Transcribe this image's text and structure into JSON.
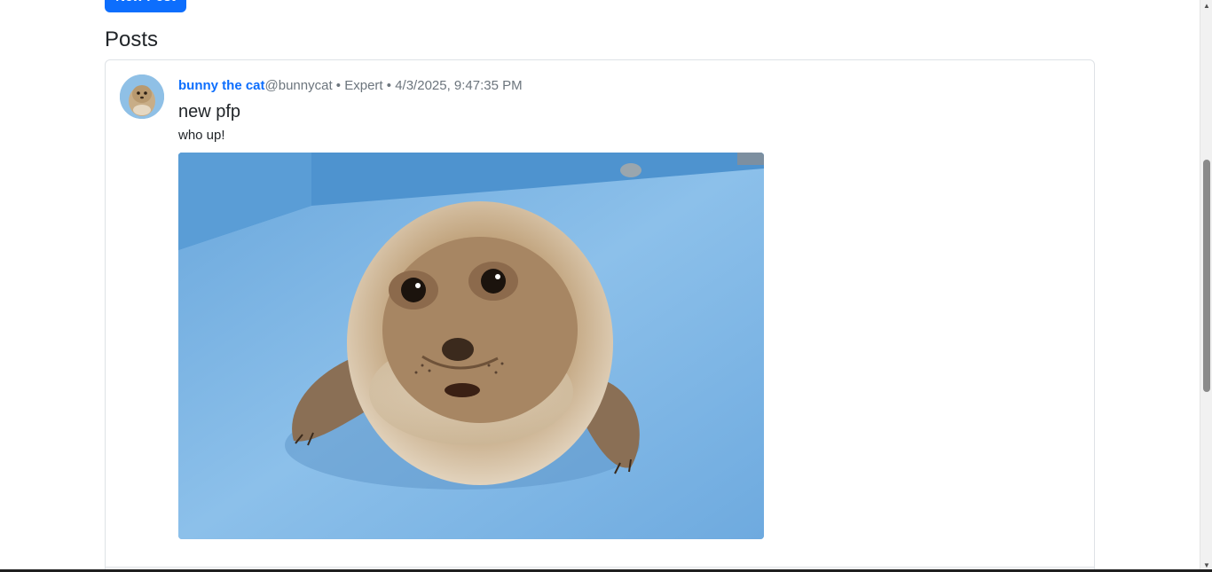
{
  "toolbar": {
    "new_post_label": "New Post"
  },
  "posts_section": {
    "heading": "Posts"
  },
  "posts": [
    {
      "author_name": "bunny the cat",
      "handle": "@bunnycat",
      "separator": "•",
      "role": "Expert",
      "timestamp": "4/3/2025, 9:47:35 PM",
      "title": "new pfp",
      "body": "who up!",
      "avatar_icon": "seal-avatar-icon",
      "image_icon": "seal-photo"
    }
  ],
  "colors": {
    "link": "#0d6efd",
    "muted": "#6c757d",
    "border": "#dee2e6",
    "primary_button": "#0d6efd"
  }
}
